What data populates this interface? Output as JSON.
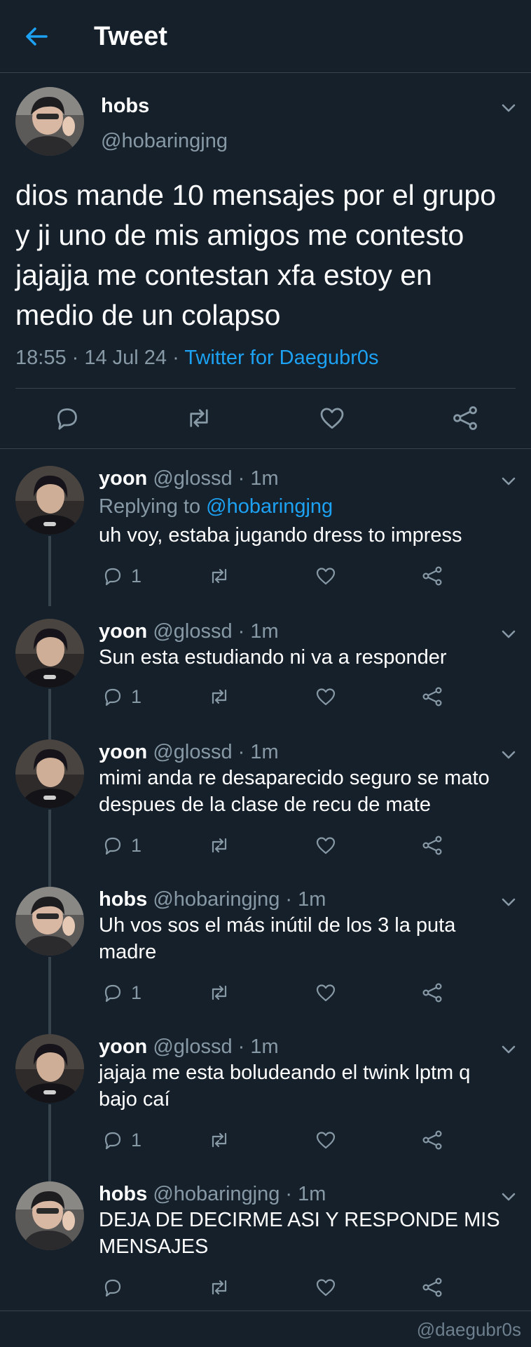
{
  "header": {
    "title": "Tweet",
    "back_icon": "arrow-left-icon",
    "accent": "#1da1f2"
  },
  "main_tweet": {
    "name": "hobs",
    "handle": "@hobaringjng",
    "text": "dios mande 10 mensajes por el grupo y ji uno de mis amigos me contesto jajajja me contestan xfa estoy en medio de un colapso",
    "time": "18:55",
    "sep1": " · ",
    "date": "14 Jul 24",
    "sep2": " · ",
    "source": "Twitter for Daegubr0s"
  },
  "replies": [
    {
      "name": "yoon",
      "handle": "@glossd",
      "dot": " · ",
      "time": "1m",
      "replying_prefix": "Replying to ",
      "replying_to": "@hobaringjng",
      "text": "uh voy, estaba jugando dress to impress",
      "reply_count": "1"
    },
    {
      "name": "yoon",
      "handle": "@glossd",
      "dot": " · ",
      "time": "1m",
      "text": "Sun esta estudiando ni va a responder",
      "reply_count": "1"
    },
    {
      "name": "yoon",
      "handle": "@glossd",
      "dot": " · ",
      "time": "1m",
      "text": "mimi anda re desaparecido seguro se mato despues de la clase de recu de mate",
      "reply_count": "1"
    },
    {
      "name": "hobs",
      "handle": "@hobaringjng",
      "dot": " · ",
      "time": "1m",
      "text": "Uh vos sos el más inútil de los 3 la puta madre",
      "reply_count": "1"
    },
    {
      "name": "yoon",
      "handle": "@glossd",
      "dot": " · ",
      "time": "1m",
      "text": "jajaja me esta boludeando el twink lptm q bajo caí",
      "reply_count": "1"
    },
    {
      "name": "hobs",
      "handle": "@hobaringjng",
      "dot": " · ",
      "time": "1m",
      "text": "DEJA DE DECIRME ASI Y RESPONDE MIS MENSAJES",
      "reply_count": ""
    }
  ],
  "watermark": "@daegubr0s",
  "icons": [
    "arrow-left-icon",
    "chevron-down-icon",
    "reply-icon",
    "retweet-icon",
    "like-icon",
    "share-icon"
  ]
}
